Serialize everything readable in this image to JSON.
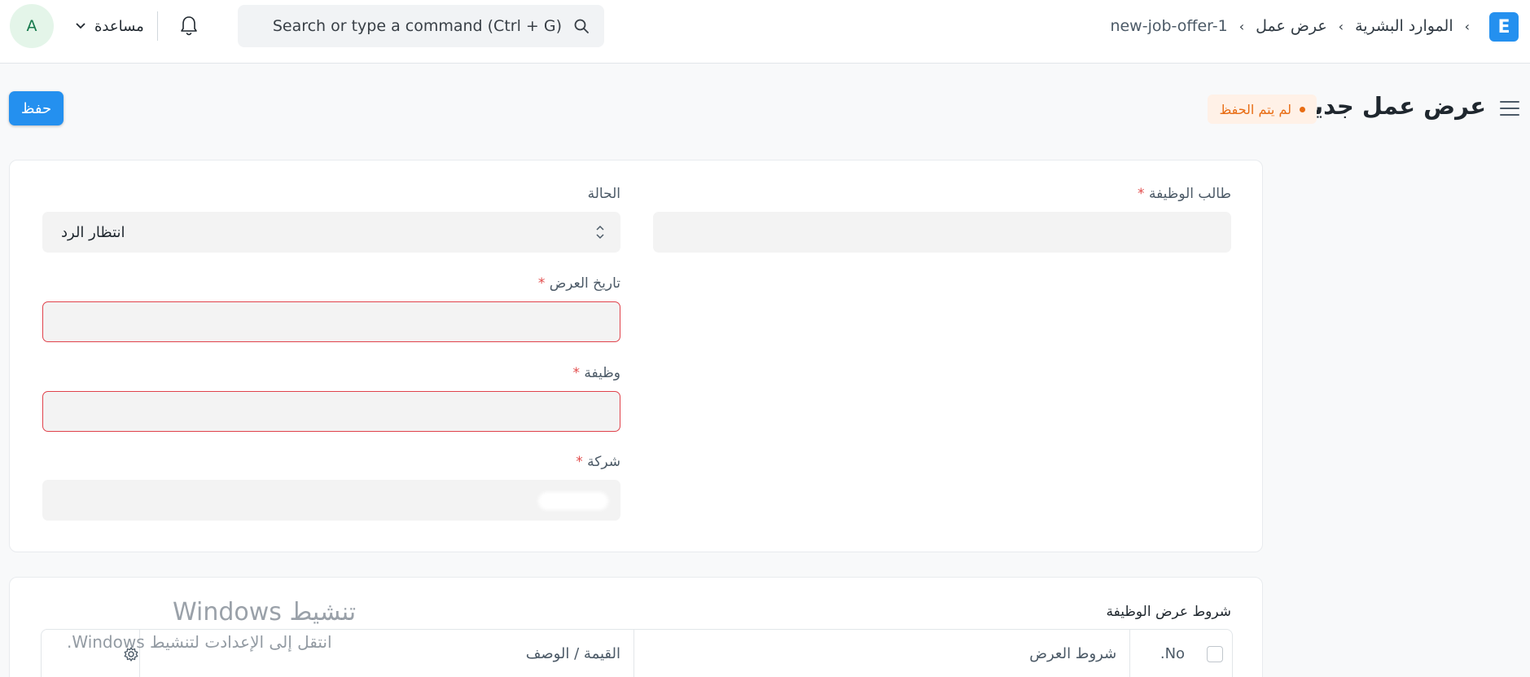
{
  "navbar": {
    "logo_letter": "E",
    "breadcrumbs": [
      "الموارد البشرية",
      "عرض عمل",
      "new-job-offer-1"
    ],
    "search_placeholder": "Search or type a command (Ctrl + G)",
    "help_label": "مساعدة",
    "avatar_initial": "A",
    "icons": [
      "search-icon",
      "bell-icon",
      "chevron-down-icon"
    ]
  },
  "page_head": {
    "title": "عرض عمل جديد",
    "status": "لم يتم الحفظ",
    "save_label": "حفظ",
    "colors": {
      "primary": "#2490ef",
      "status_text": "#e86c13",
      "status_bg": "#fff1e7",
      "error_border": "#e0424b"
    }
  },
  "form": {
    "applicant": {
      "label": "طالب الوظيفة",
      "value": ""
    },
    "status": {
      "label": "الحالة",
      "value": "انتظار الرد"
    },
    "offer_date": {
      "label": "تاريخ العرض",
      "value": ""
    },
    "designation": {
      "label": "وظيفة",
      "value": ""
    },
    "company": {
      "label": "شركة",
      "value": ""
    },
    "required_mark": "*"
  },
  "terms": {
    "title": "شروط عرض الوظيفة",
    "columns": {
      "no": "No.",
      "term": "شروط العرض",
      "value": "القيمة / الوصف"
    }
  },
  "watermark": {
    "title": "تنشيط Windows",
    "subtitle": "انتقل إلى الإعدادت لتنشيط Windows."
  }
}
